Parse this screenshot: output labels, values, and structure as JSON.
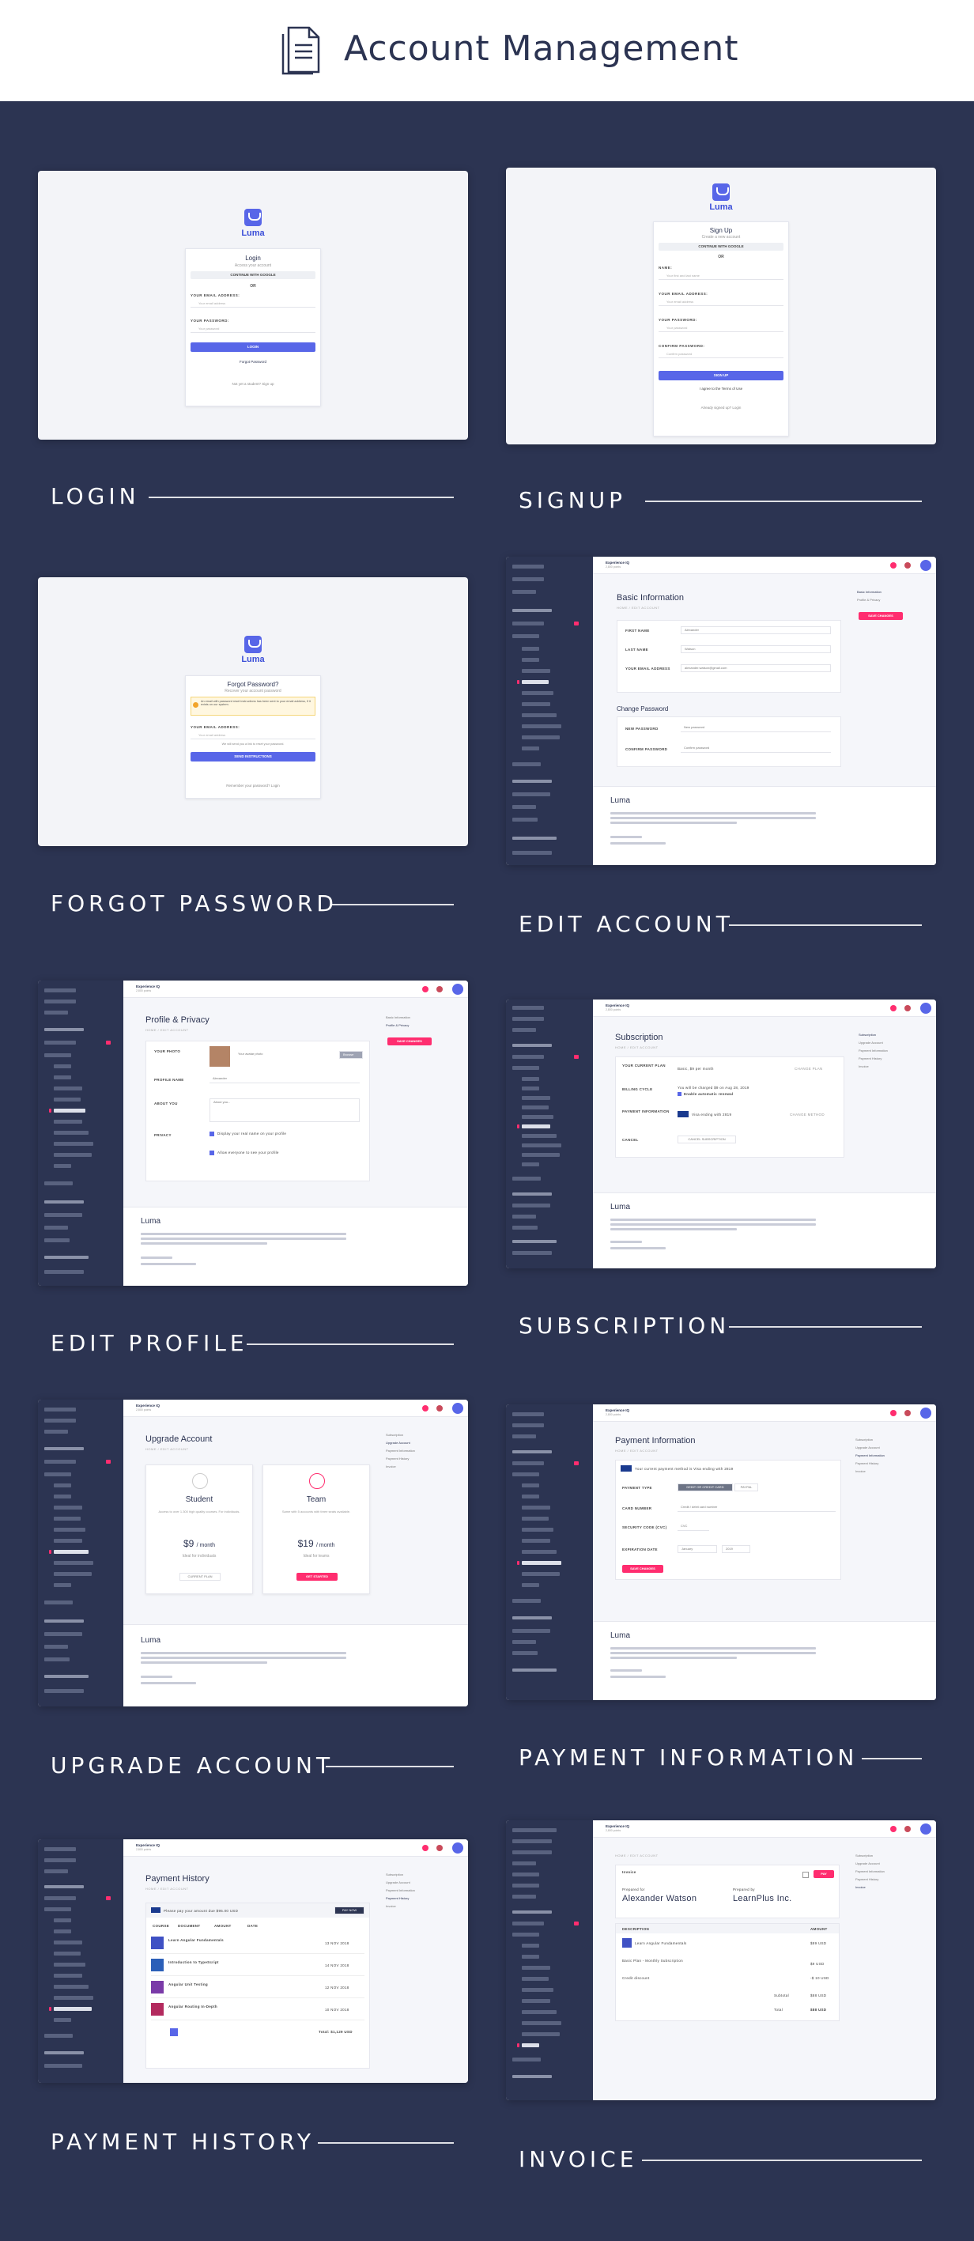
{
  "header": {
    "title": "Account Management",
    "icon": "document-icon"
  },
  "sections": [
    {
      "label": "LOGIN"
    },
    {
      "label": "SIGNUP"
    },
    {
      "label": "FORGOT PASSWORD"
    },
    {
      "label": "EDIT ACCOUNT"
    },
    {
      "label": "EDIT PROFILE"
    },
    {
      "label": "SUBSCRIPTION"
    },
    {
      "label": "UPGRADE ACCOUNT"
    },
    {
      "label": "PAYMENT INFORMATION"
    },
    {
      "label": "PAYMENT HISTORY"
    },
    {
      "label": "INVOICE"
    }
  ],
  "brand": {
    "name": "Luma",
    "accent": "#5866e8",
    "danger": "#ff2d6f",
    "dark": "#2c3452"
  },
  "login": {
    "title": "Login",
    "subtitle": "Access your account",
    "google": "CONTINUE WITH GOOGLE",
    "or": "OR",
    "email_label": "YOUR EMAIL ADDRESS:",
    "email_ph": "Your email address",
    "password_label": "YOUR PASSWORD:",
    "password_ph": "Your password",
    "button": "LOGIN",
    "forgot": "Forgot Password",
    "signup": "Not yet a student? Sign up"
  },
  "signup": {
    "title": "Sign Up",
    "subtitle": "Create a new account",
    "google": "CONTINUE WITH GOOGLE",
    "or": "OR",
    "name_label": "NAME:",
    "name_ph": "Your first and last name",
    "email_label": "YOUR EMAIL ADDRESS:",
    "email_ph": "Your email address",
    "password_label": "YOUR PASSWORD:",
    "password_ph": "Your password",
    "confirm_label": "CONFIRM PASSWORD:",
    "confirm_ph": "Confirm password",
    "button": "SIGN UP",
    "terms": "I agree to the Terms of Use",
    "login": "Already signed up? Login"
  },
  "forgot": {
    "title": "Forgot Password?",
    "subtitle": "Recover your account password",
    "alert": "An email with password reset instructions has been sent to your email address, if it exists on our system.",
    "email_label": "YOUR EMAIL ADDRESS:",
    "email_ph": "Your email address",
    "help": "We will send you a link to reset your password.",
    "button": "SEND INSTRUCTIONS",
    "remember": "Remember your password? Login"
  },
  "dash": {
    "brand": "Experience IQ",
    "brand_sub": "2,800 points",
    "crumb": "HOME / EDIT ACCOUNT",
    "luma": "Luma"
  },
  "edit_account": {
    "title": "Basic Information",
    "first_label": "FIRST NAME",
    "first": "Alexander",
    "last_label": "LAST NAME",
    "last": "Watson",
    "email_label": "YOUR EMAIL ADDRESS",
    "email": "alexander.watson@gmail.com",
    "change": "Change Password",
    "new_label": "NEW PASSWORD",
    "new_ph": "New password",
    "confirm_label": "CONFIRM PASSWORD",
    "confirm_ph": "Confirm password",
    "save": "SAVE CHANGES",
    "toc": [
      "Basic Information",
      "Profile & Privacy"
    ]
  },
  "edit_profile": {
    "title": "Profile & Privacy",
    "photo_label": "YOUR PHOTO",
    "photo_ph": "Your avatar photo",
    "browse": "Browse",
    "pname_label": "PROFILE NAME",
    "pname": "Alexander",
    "about_label": "ABOUT YOU",
    "about_ph": "About you...",
    "privacy_label": "PRIVACY",
    "opt1": "Display your real name on your profile",
    "opt2": "Allow everyone to see your profile",
    "save": "SAVE CHANGES",
    "toc": [
      "Basic Information",
      "Profile & Privacy"
    ]
  },
  "subscription": {
    "title": "Subscription",
    "plan_label": "YOUR CURRENT PLAN",
    "plan": "Basic, $9 per month",
    "change": "CHANGE PLAN",
    "billing_label": "BILLING CYCLE",
    "billing": "You will be charged $9 on Aug 28, 2019",
    "auto": "Enable automatic renewal",
    "payment_label": "PAYMENT INFORMATION",
    "payment": "Visa ending with 2819",
    "change_method": "CHANGE METHOD",
    "cancel_label": "CANCEL",
    "cancel": "CANCEL SUBSCRIPTION",
    "toc": [
      "Subscription",
      "Upgrade Account",
      "Payment Information",
      "Payment History",
      "Invoice"
    ]
  },
  "upgrade": {
    "title": "Upgrade Account",
    "plans": [
      {
        "name": "Student",
        "desc": "Access to over 1.300 high quality courses. For individuals.",
        "price": "$9",
        "per": "/ month",
        "note": "Ideal for individuals",
        "button": "CURRENT PLAN"
      },
      {
        "name": "Team",
        "desc": "Same with 5 accounts with three seats available.",
        "price": "$19",
        "per": "/ month",
        "note": "Ideal for teams",
        "button": "GET STARTED"
      }
    ],
    "toc": [
      "Subscription",
      "Upgrade Account",
      "Payment Information",
      "Payment History",
      "Invoice"
    ]
  },
  "payment_info": {
    "title": "Payment Information",
    "current": "Your current payment method is Visa ending with 2819",
    "type_label": "PAYMENT TYPE",
    "type1": "DEBIT OR CREDIT CARD",
    "type2": "PAYPAL",
    "card_label": "CARD NUMBER",
    "card_ph": "Credit / debit card number",
    "cvc_label": "SECURITY CODE (CVC)",
    "cvc_ph": "CVC",
    "exp_label": "EXPIRATION DATE",
    "month": "January",
    "year": "2019",
    "save": "SAVE CHANGES",
    "toc": [
      "Subscription",
      "Upgrade Account",
      "Payment Information",
      "Payment History",
      "Invoice"
    ]
  },
  "payment_history": {
    "title": "Payment History",
    "due": "Please pay your amount due $95.00 USD",
    "pay": "PAY NOW",
    "cols": [
      "COURSE",
      "DOCUMENT",
      "AMOUNT",
      "DATE"
    ],
    "rows": [
      {
        "course": "Learn Angular Fundamentals",
        "date": "13 NOV 2018"
      },
      {
        "course": "Introduction to TypeScript",
        "date": "14 NOV 2018"
      },
      {
        "course": "Angular Unit Testing",
        "date": "12 NOV 2018"
      },
      {
        "course": "Angular Routing In-Depth",
        "date": "10 NOV 2018"
      }
    ],
    "total": "Total: $1,129 USD",
    "toc": [
      "Subscription",
      "Upgrade Account",
      "Payment Information",
      "Payment History",
      "Invoice"
    ]
  },
  "invoice": {
    "crumb": "HOME / EDIT ACCOUNT",
    "title": "Invoice",
    "pay": "PAY",
    "prepared_for": "Prepared for",
    "client": "Alexander Watson",
    "prepared_by": "Prepared by",
    "company": "LearnPlus Inc.",
    "cols": [
      "DESCRIPTION",
      "AMOUNT"
    ],
    "items": [
      {
        "desc": "Learn Angular Fundamentals",
        "amount": "$89 USD"
      },
      {
        "desc": "Basic Plan - Monthly Subscription",
        "amount": "$9 USD"
      },
      {
        "desc": "Credit discount",
        "amount": "-$ 10 USD"
      }
    ],
    "subtotal_label": "Subtotal",
    "subtotal": "$88 USD",
    "total_label": "Total",
    "total": "$88 USD",
    "toc": [
      "Subscription",
      "Upgrade Account",
      "Payment Information",
      "Payment History",
      "Invoice"
    ]
  }
}
